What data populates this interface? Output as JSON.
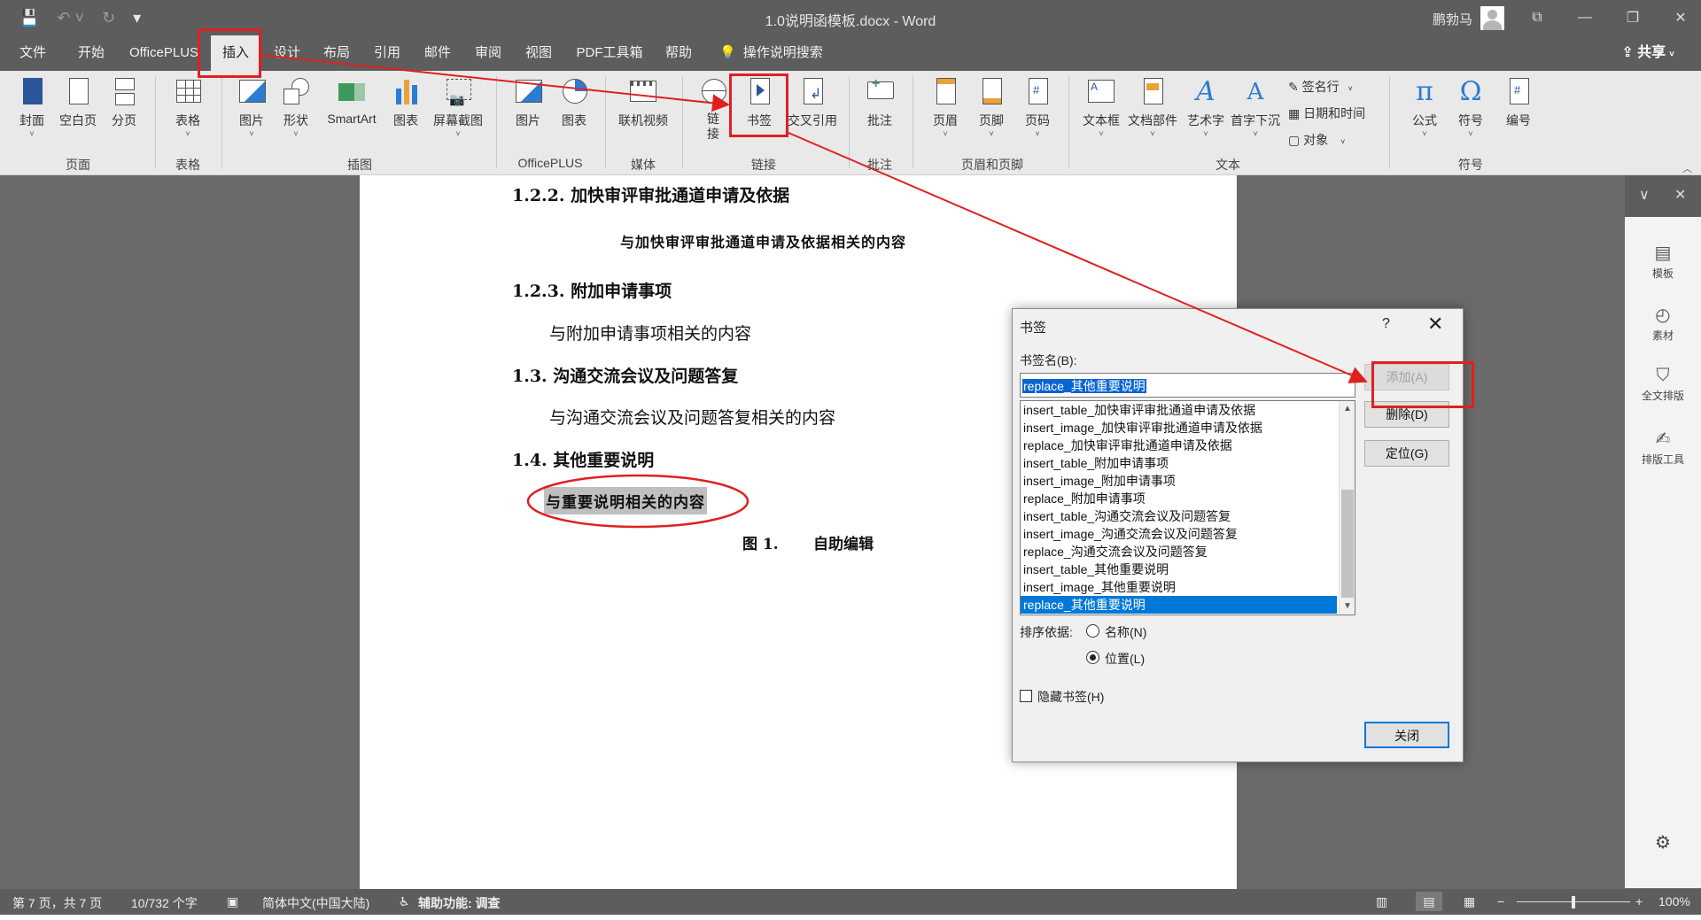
{
  "titlebar": {
    "doc_title": "1.0说明函模板.docx - Word",
    "user_name": "鹏勃马",
    "save_icon": "💾",
    "undo_icon": "↶ ˅",
    "redo_icon": "↻",
    "customize_icon": "▾",
    "ribbon_display_icon": "⧉",
    "minimize_icon": "—",
    "restore_icon": "❐",
    "close_icon": "✕"
  },
  "tabs": {
    "items": [
      "文件",
      "开始",
      "OfficePLUS",
      "插入",
      "设计",
      "布局",
      "引用",
      "邮件",
      "审阅",
      "视图",
      "PDF工具箱",
      "帮助"
    ],
    "tell_me": "操作说明搜索",
    "share": "共享"
  },
  "ribbon": {
    "buttons": {
      "cover": "封面",
      "blank_page": "空白页",
      "page_break": "分页",
      "table": "表格",
      "picture": "图片",
      "shapes": "形状",
      "smartart": "SmartArt",
      "chart": "图表",
      "screenshot": "屏幕截图",
      "officeplus_picture": "图片",
      "officeplus_chart": "图表",
      "online_video": "联机视频",
      "link": "链接",
      "bookmark": "书签",
      "cross_ref": "交叉引用",
      "comment": "批注",
      "header": "页眉",
      "footer": "页脚",
      "page_number": "页码",
      "textbox": "文本框",
      "quick_parts": "文档部件",
      "wordart": "艺术字",
      "drop_cap": "首字下沉",
      "signature_line": "签名行",
      "date_time": "日期和时间",
      "object": "对象",
      "equation": "公式",
      "symbol": "符号",
      "numbering": "编号"
    },
    "groups": {
      "pages": "页面",
      "tables": "表格",
      "illustrations": "插图",
      "officeplus": "OfficePLUS",
      "media": "媒体",
      "links": "链接",
      "comments": "批注",
      "header_footer": "页眉和页脚",
      "text": "文本",
      "symbols": "符号"
    }
  },
  "document": {
    "h_122": "1.2.2. 加快审评审批通道申请及依据",
    "p_122": "与加快审评审批通道申请及依据相关的内容",
    "h_123": "1.2.3. 附加申请事项",
    "p_123": "与附加申请事项相关的内容",
    "h_13": "1.3. 沟通交流会议及问题答复",
    "p_13": "与沟通交流会议及问题答复相关的内容",
    "h_14": "1.4. 其他重要说明",
    "p_14": "与重要说明相关的内容",
    "caption_num": "图 1.",
    "caption_text": "自助编辑"
  },
  "side_panel": {
    "items": [
      "模板",
      "素材",
      "全文排版",
      "排版工具"
    ],
    "collapse_icon": "∨",
    "close_icon": "✕",
    "settings_icon": "⚙"
  },
  "dialog": {
    "title": "书签",
    "help": "?",
    "close": "✕",
    "name_label": "书签名(B):",
    "name_value": "replace_其他重要说明",
    "list": [
      "insert_table_加快审评审批通道申请及依据",
      "insert_image_加快审评审批通道申请及依据",
      "replace_加快审评审批通道申请及依据",
      "insert_table_附加申请事项",
      "insert_image_附加申请事项",
      "replace_附加申请事项",
      "insert_table_沟通交流会议及问题答复",
      "insert_image_沟通交流会议及问题答复",
      "replace_沟通交流会议及问题答复",
      "insert_table_其他重要说明",
      "insert_image_其他重要说明",
      "replace_其他重要说明"
    ],
    "selected_index": 11,
    "btn_add": "添加(A)",
    "btn_delete": "删除(D)",
    "btn_goto": "定位(G)",
    "sort_label": "排序依据:",
    "sort_name": "名称(N)",
    "sort_position": "位置(L)",
    "sort_selected": "位置(L)",
    "hide_label": "隐藏书签(H)",
    "hide_checked": false,
    "btn_close": "关闭"
  },
  "status": {
    "page": "第 7 页，共 7 页",
    "words": "10/732 个字",
    "language": "简体中文(中国大陆)",
    "accessibility": "辅助功能: 调查",
    "zoom": "100%",
    "zoom_minus": "−",
    "zoom_plus": "+",
    "zoom_level": 0.5
  },
  "colors": {
    "accent": "#2b579a",
    "annotation": "#e02020",
    "selection": "#0078d7"
  }
}
